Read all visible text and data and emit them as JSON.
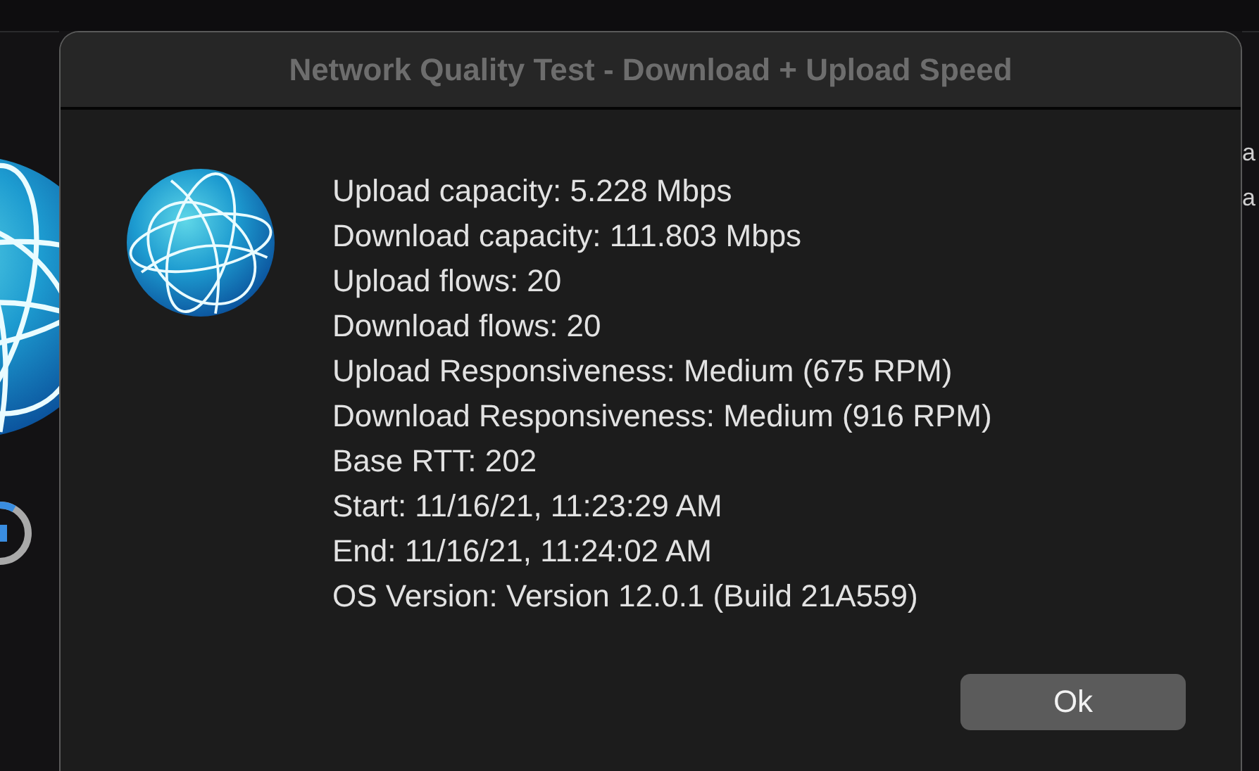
{
  "background_window": {
    "texts": [
      "a",
      "a"
    ]
  },
  "dialog": {
    "title": "Network Quality Test - Download + Upload Speed",
    "lines": [
      "Upload capacity: 5.228 Mbps",
      "Download capacity: 111.803 Mbps",
      "Upload flows: 20",
      "Download flows: 20",
      "Upload Responsiveness: Medium (675 RPM)",
      "Download Responsiveness: Medium (916 RPM)",
      "Base RTT: 202",
      "Start: 11/16/21, 11:23:29 AM",
      "End: 11/16/21, 11:24:02 AM",
      "OS Version: Version 12.0.1 (Build 21A559)"
    ],
    "buttons": [
      "Ok"
    ]
  }
}
